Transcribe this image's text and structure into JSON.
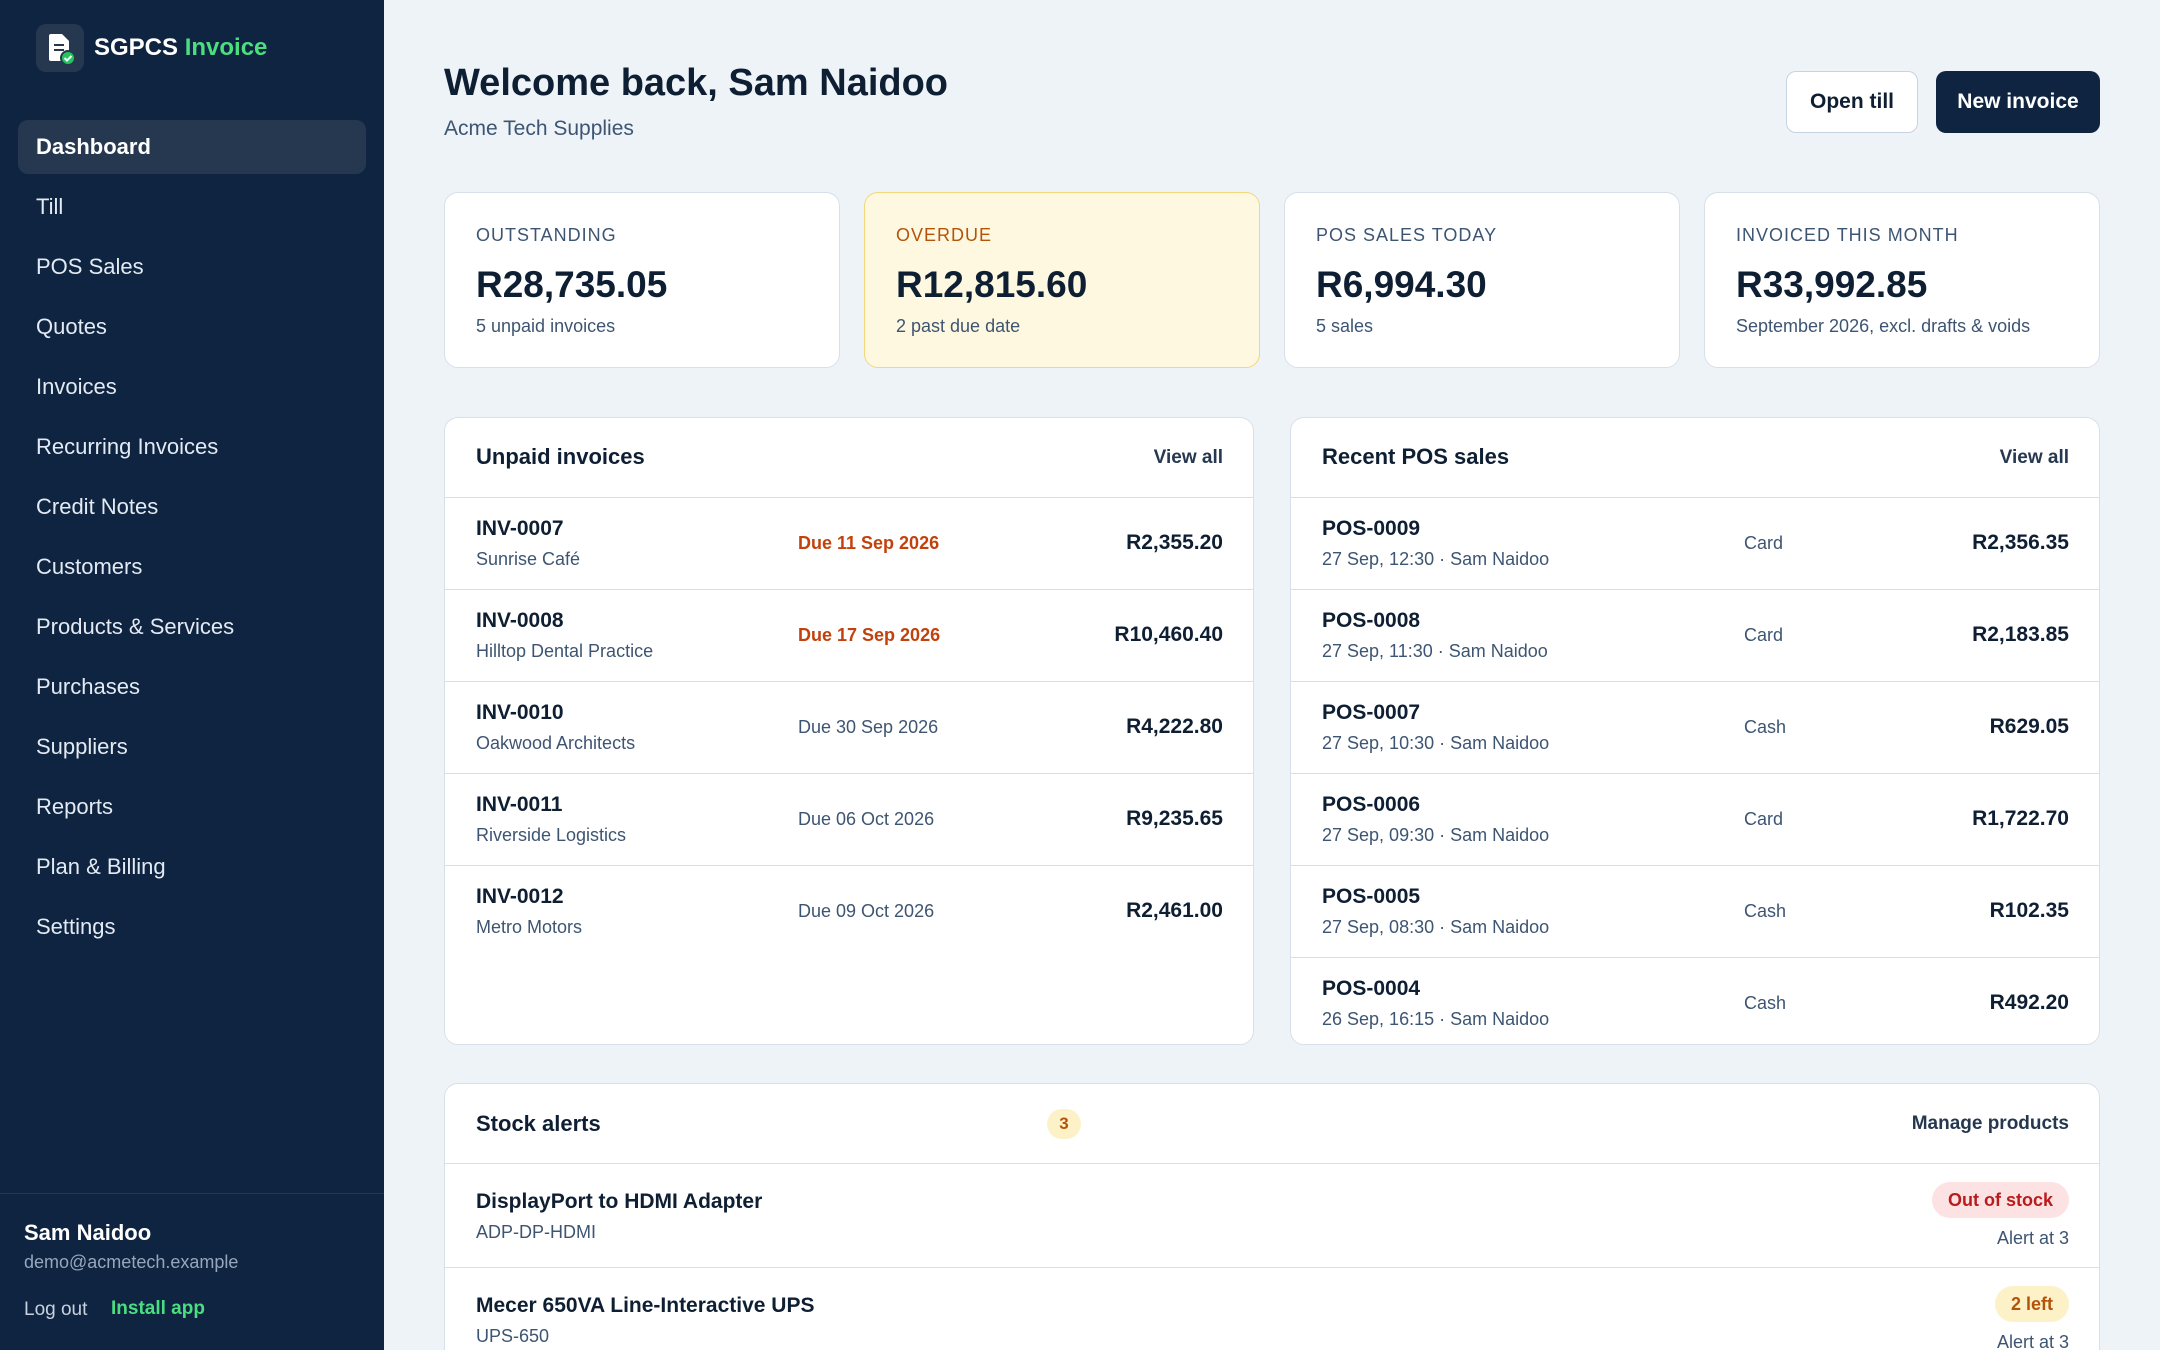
{
  "brand": {
    "name": "SGPCS",
    "accent": "Invoice",
    "logo_icon": "document-check-icon"
  },
  "nav": [
    {
      "label": "Dashboard",
      "active": true
    },
    {
      "label": "Till"
    },
    {
      "label": "POS Sales"
    },
    {
      "label": "Quotes"
    },
    {
      "label": "Invoices"
    },
    {
      "label": "Recurring Invoices"
    },
    {
      "label": "Credit Notes"
    },
    {
      "label": "Customers"
    },
    {
      "label": "Products & Services"
    },
    {
      "label": "Purchases"
    },
    {
      "label": "Suppliers"
    },
    {
      "label": "Reports"
    },
    {
      "label": "Plan & Billing"
    },
    {
      "label": "Settings"
    }
  ],
  "user": {
    "name": "Sam Naidoo",
    "email": "demo@acmetech.example",
    "logout": "Log out",
    "install": "Install app"
  },
  "header": {
    "welcome": "Welcome back, Sam Naidoo",
    "company": "Acme Tech Supplies",
    "open_till": "Open till",
    "new_invoice": "New invoice"
  },
  "stats": [
    {
      "label": "OUTSTANDING",
      "value": "R28,735.05",
      "sub": "5 unpaid invoices"
    },
    {
      "label": "OVERDUE",
      "value": "R12,815.60",
      "sub": "2 past due date"
    },
    {
      "label": "POS SALES TODAY",
      "value": "R6,994.30",
      "sub": "5 sales"
    },
    {
      "label": "INVOICED THIS MONTH",
      "value": "R33,992.85",
      "sub": "September 2026, excl. drafts & voids"
    }
  ],
  "unpaid": {
    "title": "Unpaid invoices",
    "view_all": "View all",
    "rows": [
      {
        "id": "INV-0007",
        "customer": "Sunrise Café",
        "due": "Due 11 Sep 2026",
        "overdue": true,
        "amount": "R2,355.20"
      },
      {
        "id": "INV-0008",
        "customer": "Hilltop Dental Practice",
        "due": "Due 17 Sep 2026",
        "overdue": true,
        "amount": "R10,460.40"
      },
      {
        "id": "INV-0010",
        "customer": "Oakwood Architects",
        "due": "Due 30 Sep 2026",
        "overdue": false,
        "amount": "R4,222.80"
      },
      {
        "id": "INV-0011",
        "customer": "Riverside Logistics",
        "due": "Due 06 Oct 2026",
        "overdue": false,
        "amount": "R9,235.65"
      },
      {
        "id": "INV-0012",
        "customer": "Metro Motors",
        "due": "Due 09 Oct 2026",
        "overdue": false,
        "amount": "R2,461.00"
      }
    ]
  },
  "pos": {
    "title": "Recent POS sales",
    "view_all": "View all",
    "rows": [
      {
        "id": "POS-0009",
        "meta": "27 Sep, 12:30 · Sam Naidoo",
        "method": "Card",
        "amount": "R2,356.35"
      },
      {
        "id": "POS-0008",
        "meta": "27 Sep, 11:30 · Sam Naidoo",
        "method": "Card",
        "amount": "R2,183.85"
      },
      {
        "id": "POS-0007",
        "meta": "27 Sep, 10:30 · Sam Naidoo",
        "method": "Cash",
        "amount": "R629.05"
      },
      {
        "id": "POS-0006",
        "meta": "27 Sep, 09:30 · Sam Naidoo",
        "method": "Card",
        "amount": "R1,722.70"
      },
      {
        "id": "POS-0005",
        "meta": "27 Sep, 08:30 · Sam Naidoo",
        "method": "Cash",
        "amount": "R102.35"
      },
      {
        "id": "POS-0004",
        "meta": "26 Sep, 16:15 · Sam Naidoo",
        "method": "Cash",
        "amount": "R492.20"
      }
    ]
  },
  "stock": {
    "title": "Stock alerts",
    "count": "3",
    "manage": "Manage products",
    "rows": [
      {
        "name": "DisplayPort to HDMI Adapter",
        "sku": "ADP-DP-HDMI",
        "status": "Out of stock",
        "status_color": "#b91c1c",
        "alert": "Alert at 3"
      },
      {
        "name": "Mecer 650VA Line-Interactive UPS",
        "sku": "UPS-650",
        "status": "2 left",
        "status_color": "#b45309",
        "alert": "Alert at 3"
      }
    ]
  },
  "colors": {
    "sidebar": "#0f2440",
    "accent_green": "#4ade80",
    "warn": "#b45309",
    "danger": "#b91c1c",
    "background": "#eef3f8"
  }
}
